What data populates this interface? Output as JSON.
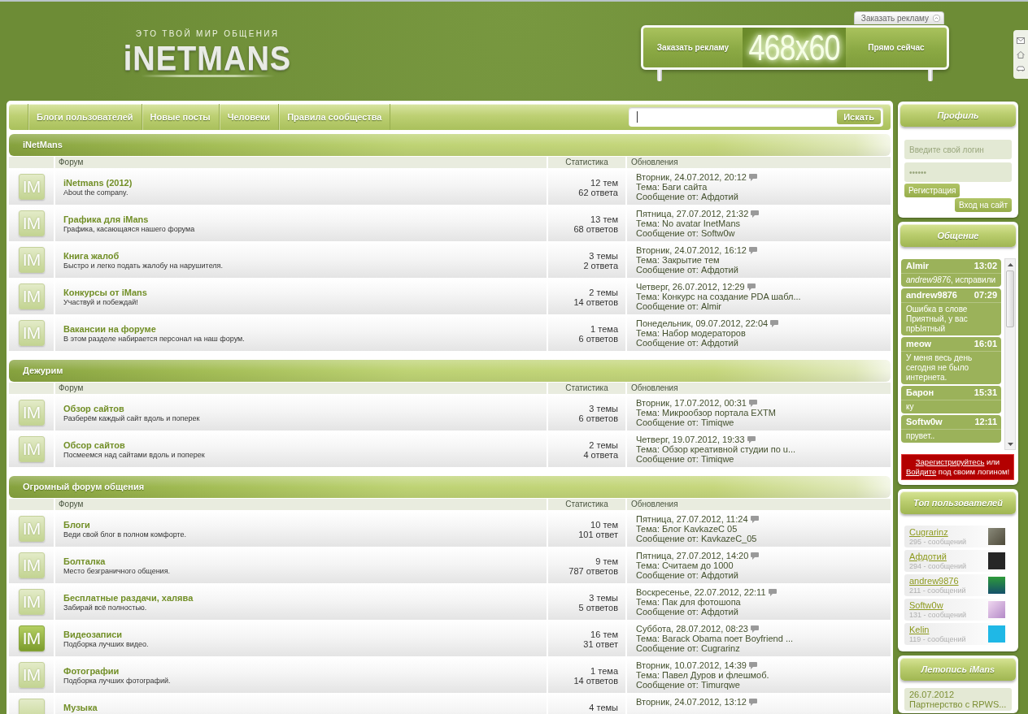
{
  "header": {
    "tagline": "ЭТО ТВОЙ МИР ОБЩЕНИЯ",
    "logo": "iNETMANS"
  },
  "ad": {
    "tab": "Заказать рекламу",
    "left_text": "Заказать рекламу",
    "size": "468x60",
    "right_text": "Прямо сейчас"
  },
  "nav": [
    "Блоги пользователей",
    "Новые посты",
    "Человеки",
    "Правила сообщества"
  ],
  "search": {
    "button": "Искать"
  },
  "categories": [
    {
      "title": "iNetMans",
      "columns": [
        "Форум",
        "Статистика",
        "Обновления"
      ],
      "forums": [
        {
          "icon_text": "IM",
          "has_new": false,
          "title": "iNetmans (2012)",
          "description": "About the company.",
          "topics": "12 тем",
          "replies": "62 ответа",
          "last_post": [
            "Вторник, 24.07.2012, 20:12",
            "Тема: Баги сайта",
            "Сообщение от: Афдотий"
          ]
        },
        {
          "icon_text": "IM",
          "has_new": false,
          "title": "Графика для iMans",
          "description": "Графика, касающаяся нашего форума",
          "topics": "13 тем",
          "replies": "68 ответов",
          "last_post": [
            "Пятница, 27.07.2012, 21:32",
            "Тема: No avatar InetMans",
            "Сообщение от: Softw0w"
          ]
        },
        {
          "icon_text": "IM",
          "has_new": false,
          "title": "Книга жалоб",
          "description": "Быстро и легко подать жалобу на нарушителя.",
          "topics": "3 темы",
          "replies": "2 ответа",
          "last_post": [
            "Вторник, 24.07.2012, 16:12",
            "Тема: Закрытие тем",
            "Сообщение от: Афдотий"
          ]
        },
        {
          "icon_text": "IM",
          "has_new": false,
          "title": "Конкурсы от iMans",
          "description": "Участвуй и побеждай!",
          "topics": "2 темы",
          "replies": "14 ответов",
          "last_post": [
            "Четверг, 26.07.2012, 12:29",
            "Тема: Конкурс на создание PDA шабл...",
            "Сообщение от: Almir"
          ]
        },
        {
          "icon_text": "IM",
          "has_new": false,
          "title": "Вакансии на форуме",
          "description": "В этом разделе набирается персонал на наш форум.",
          "topics": "1 тема",
          "replies": "6 ответов",
          "last_post": [
            "Понедельник, 09.07.2012, 22:04",
            "Тема: Набор модераторов",
            "Сообщение от: Афдотий"
          ]
        }
      ]
    },
    {
      "title": "Дежурим",
      "columns": [
        "Форум",
        "Статистика",
        "Обновления"
      ],
      "forums": [
        {
          "icon_text": "IM",
          "has_new": false,
          "title": "Обзор сайтов",
          "description": "Разберём каждый сайт вдоль и поперек",
          "topics": "3 темы",
          "replies": "6 ответов",
          "last_post": [
            "Вторник, 17.07.2012, 00:31",
            "Тема: Микрообзор портала EXTM",
            "Сообщение от: Timiqwe"
          ]
        },
        {
          "icon_text": "IM",
          "has_new": false,
          "title": "Обсор сайтов",
          "description": "Посмеемся над сайтами вдоль и поперек",
          "topics": "2 темы",
          "replies": "4 ответа",
          "last_post": [
            "Четверг, 19.07.2012, 19:33",
            "Тема: Обзор креативной студии по u...",
            "Сообщение от: Timiqwe"
          ]
        }
      ]
    },
    {
      "title": "Огромный форум общения",
      "columns": [
        "Форум",
        "Статистика",
        "Обновления"
      ],
      "forums": [
        {
          "icon_text": "IM",
          "has_new": false,
          "title": "Блоги",
          "description": "Веди свой блог в полном комфорте.",
          "topics": "10 тем",
          "replies": "101 ответ",
          "last_post": [
            "Пятница, 27.07.2012, 11:24",
            "Тема: Блог KavkazeC 05",
            "Сообщение от: KavkazeC_05"
          ]
        },
        {
          "icon_text": "IM",
          "has_new": false,
          "title": "Болталка",
          "description": "Место безграничного общения.",
          "topics": "9 тем",
          "replies": "787 ответов",
          "last_post": [
            "Пятница, 27.07.2012, 14:20",
            "Тема: Считаем до 1000",
            "Сообщение от: Афдотий"
          ]
        },
        {
          "icon_text": "IM",
          "has_new": false,
          "title": "Бесплатные раздачи, халява",
          "description": "Забирай всё полностью.",
          "topics": "3 темы",
          "replies": "5 ответов",
          "last_post": [
            "Воскресенье, 22.07.2012, 22:11",
            "Тема: Пак для фотошопа",
            "Сообщение от: Афдотий"
          ]
        },
        {
          "icon_text": "IM",
          "has_new": true,
          "title": "Видеозаписи",
          "description": "Подборка лучших видео.",
          "topics": "16 тем",
          "replies": "31 ответ",
          "last_post": [
            "Суббота, 28.07.2012, 08:23",
            "Тема: Barack Obama поет Boyfriend ...",
            "Сообщение от: Cugrarinz"
          ]
        },
        {
          "icon_text": "IM",
          "has_new": false,
          "title": "Фотографии",
          "description": "Подборка лучших фотографий.",
          "topics": "1 тема",
          "replies": "14 ответов",
          "last_post": [
            "Вторник, 10.07.2012, 14:39",
            "Тема: Павел Дуров и флешмоб.",
            "Сообщение от: Timurqwe"
          ]
        },
        {
          "has_new": false,
          "title": "Музыка",
          "topics": "4 темы",
          "last_post": [
            "Вторник, 24.07.2012, 13:12"
          ]
        }
      ]
    }
  ],
  "profile": {
    "title": "Профиль",
    "login": {
      "placeholder": "Введите свой логин"
    },
    "password": {
      "placeholder": "••••••"
    },
    "register_button": "Регистрация",
    "login_button": "Вход на сайт"
  },
  "chat": {
    "title": "Общение",
    "messages": [
      {
        "author": "Almir",
        "time": "13:02",
        "text": "*andrew9876*, исправили"
      },
      {
        "author": "andrew9876",
        "time": "07:29",
        "text": "Ошибка в слове Приятный, у вас прЫятный"
      },
      {
        "author": "meow",
        "time": "16:01",
        "text": "У меня весь день сегодня не было интернета."
      },
      {
        "author": "Барон",
        "time": "15:31",
        "text": "ку"
      },
      {
        "author": "Softw0w",
        "time": "12:11",
        "text": "прувет.."
      }
    ],
    "notice": [
      {
        "kind": "link",
        "text": "Зарегистрируйтесь"
      },
      {
        "kind": "text",
        "text": "или"
      },
      {
        "kind": "link",
        "text": "Войдите"
      },
      {
        "kind": "text",
        "text": "под своим логином!"
      }
    ]
  },
  "top_users": {
    "title": "Топ пользователей",
    "users": [
      {
        "name": "Cugrarinz",
        "posts": "295 - сообщений"
      },
      {
        "name": "Афдотий",
        "posts": "294 - сообщений"
      },
      {
        "name": "andrew9876",
        "posts": "211 - сообщений"
      },
      {
        "name": "Softw0w",
        "posts": "131 - сообщений"
      },
      {
        "name": "Kelin",
        "posts": "119 - сообщений"
      }
    ]
  },
  "chronicle": {
    "title": "Летопись iMans",
    "items": [
      {
        "date": "26.07.2012",
        "text": "Партнерство с RPWS..."
      }
    ]
  }
}
